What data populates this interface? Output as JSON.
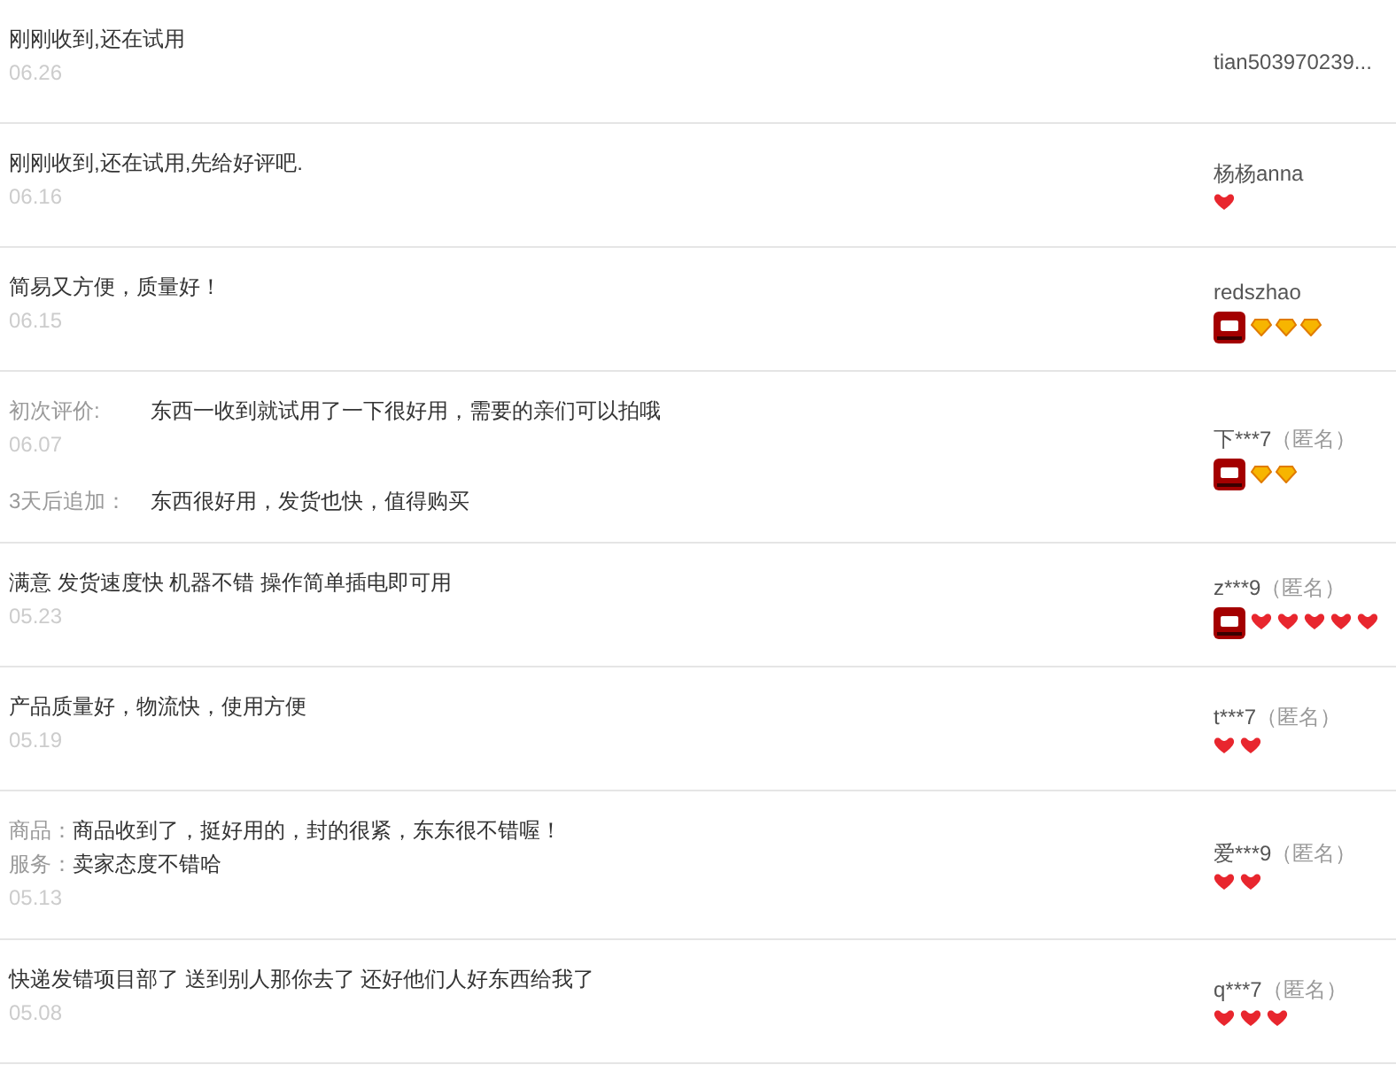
{
  "reviews": [
    {
      "kind": "simple",
      "text": "刚刚收到,还在试用",
      "date": "06.26",
      "user": {
        "name": "tian503970239..."
      }
    },
    {
      "kind": "simple",
      "text": "刚刚收到,还在试用,先给好评吧.",
      "date": "06.16",
      "user": {
        "name": "杨杨anna",
        "rank_icons": [
          {
            "kind": "heart"
          }
        ]
      }
    },
    {
      "kind": "simple",
      "text": "简易又方便，质量好！",
      "date": "06.15",
      "user": {
        "name": "redszhao",
        "vip": true,
        "rank_icons": [
          {
            "kind": "diamond"
          },
          {
            "kind": "diamond"
          },
          {
            "kind": "diamond"
          }
        ]
      }
    },
    {
      "kind": "appended",
      "first_label": "初次评价:",
      "text": "东西一收到就试用了一下很好用，需要的亲们可以拍哦",
      "date": "06.07",
      "append_label": "3天后追加：",
      "append_text": "东西很好用，发货也快，值得购买",
      "user": {
        "name": "下***7",
        "anonymous": "（匿名）",
        "vip": true,
        "rank_icons": [
          {
            "kind": "diamond"
          },
          {
            "kind": "diamond"
          }
        ]
      }
    },
    {
      "kind": "simple",
      "text": "满意 发货速度快 机器不错 操作简单插电即可用",
      "date": "05.23",
      "user": {
        "name": "z***9",
        "anonymous": "（匿名）",
        "vip": true,
        "rank_icons": [
          {
            "kind": "heart"
          },
          {
            "kind": "heart"
          },
          {
            "kind": "heart"
          },
          {
            "kind": "heart"
          },
          {
            "kind": "heart"
          }
        ]
      }
    },
    {
      "kind": "simple",
      "text": "产品质量好，物流快，使用方便",
      "date": "05.19",
      "user": {
        "name": "t***7",
        "anonymous": "（匿名）",
        "rank_icons": [
          {
            "kind": "heart"
          },
          {
            "kind": "heart"
          }
        ]
      }
    },
    {
      "kind": "sectioned",
      "sections": [
        {
          "label": "商品：",
          "text": "商品收到了，挺好用的，封的很紧，东东很不错喔！"
        },
        {
          "label": "服务：",
          "text": "卖家态度不错哈"
        }
      ],
      "date": "05.13",
      "user": {
        "name": "爱***9",
        "anonymous": "（匿名）",
        "rank_icons": [
          {
            "kind": "heart"
          },
          {
            "kind": "heart"
          }
        ]
      }
    },
    {
      "kind": "simple",
      "text": "快递发错项目部了 送到别人那你去了 还好他们人好东西给我了",
      "date": "05.08",
      "user": {
        "name": "q***7",
        "anonymous": "（匿名）",
        "rank_icons": [
          {
            "kind": "heart"
          },
          {
            "kind": "heart"
          },
          {
            "kind": "heart"
          }
        ]
      }
    }
  ]
}
